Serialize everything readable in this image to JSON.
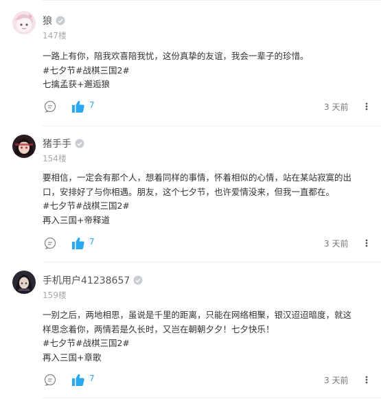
{
  "comments": [
    {
      "username": "狼",
      "floor": "147楼",
      "lines": [
        "一路上有你，陪我欢喜陪我忧，这份真挚的友谊，我会一辈子的珍惜。",
        "#七夕节#战棋三国2#",
        "七擒孟获+邂逅狼"
      ],
      "like_count": "7",
      "time": "3 天前",
      "avatar_colors": [
        "#f3d9e0",
        "#f8f1f4",
        "#6a5a66"
      ]
    },
    {
      "username": "猪手手",
      "floor": "154楼",
      "lines": [
        "要相信，一定会有那个人，想着同样的事情，怀着相似的心情，站在某站寂寞的出",
        "口，安排好了与你相遇。朋友，这个七夕节，也许爱情没来，但我一直都在。",
        "#七夕节#战棋三国2#",
        "再入三国+帝释道"
      ],
      "like_count": "7",
      "time": "3 天前",
      "avatar_colors": [
        "#2a1c22",
        "#b0323b",
        "#e8c9b8"
      ]
    },
    {
      "username": "手机用户41238657",
      "floor": "159楼",
      "lines": [
        "一别之后，两地相思，虽说是千里的距离，只能在网络相聚，银汉迢迢暗度，就这",
        "样思念着你，两情若是久长时，又岂在朝朝夕夕！七夕快乐！",
        "#七夕节#战棋三国2#",
        "再入三国+章歌"
      ],
      "like_count": "7",
      "time": "3 天前",
      "avatar_colors": [
        "#1f1d24",
        "#3b3545",
        "#e6d3c8"
      ]
    }
  ],
  "colors": {
    "like": "#2aa8f0",
    "badge": "#c9cdd3",
    "icon_gray": "#888888"
  },
  "icons": {
    "reply": "comment-bubble-icon",
    "like": "thumbs-up-icon",
    "more": "vertical-ellipsis-icon",
    "badge": "user-level-badge-icon"
  }
}
